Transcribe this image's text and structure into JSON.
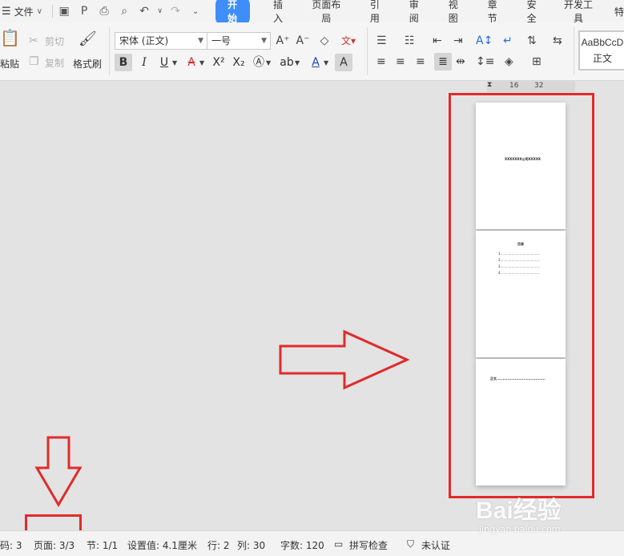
{
  "menubar": {
    "file_label": "文件",
    "tabs": [
      "开始",
      "插入",
      "页面布局",
      "引用",
      "审阅",
      "视图",
      "章节",
      "安全",
      "开发工具",
      "特"
    ]
  },
  "ribbon": {
    "paste": "粘贴",
    "cut": "剪切",
    "copy": "复制",
    "format_painter": "格式刷",
    "font_name": "宋体 (正文)",
    "font_size": "一号",
    "style_sample": "AaBbCcD",
    "style_name": "正文"
  },
  "ruler": {
    "ticks": [
      "16",
      "32"
    ]
  },
  "pages": [
    {
      "title": "XXXXXXX公司XXXXX"
    },
    {
      "title": "目录",
      "lines": [
        "1.......................................",
        "2.......................................",
        "3.......................................",
        "4......................................."
      ]
    },
    {
      "title": "正文........................................"
    }
  ],
  "status": {
    "page_code": "码: 3",
    "page": "页面: 3/3",
    "section": "节: 1/1",
    "setting": "设置值: 4.1厘米",
    "row": "行: 2",
    "col": "列: 30",
    "words": "字数: 120",
    "spell": "拼写检查",
    "cert": "未认证"
  },
  "watermark": {
    "logo": "Bai经验",
    "url": "jingyan.baidu.com"
  },
  "colors": {
    "accent": "#3f8ef7",
    "highlight": "#e12b2b"
  }
}
